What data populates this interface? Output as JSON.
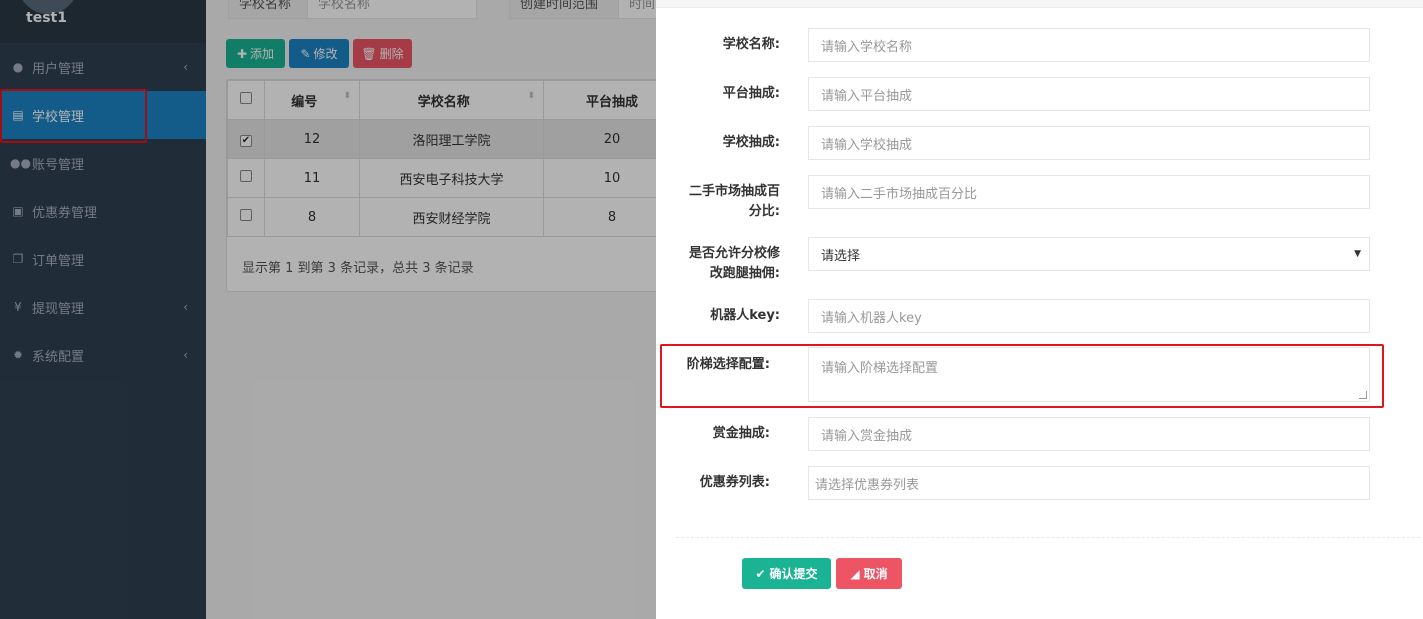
{
  "user": {
    "name": "test1"
  },
  "sidebar": {
    "items": [
      {
        "label": "用户管理",
        "icon": "user-icon",
        "glyph": "●",
        "chevron": true
      },
      {
        "label": "学校管理",
        "icon": "building-icon",
        "glyph": "▤",
        "chevron": false,
        "active": true
      },
      {
        "label": "账号管理",
        "icon": "users-icon",
        "glyph": "●●",
        "chevron": false
      },
      {
        "label": "优惠券管理",
        "icon": "money-icon",
        "glyph": "▣",
        "chevron": false
      },
      {
        "label": "订单管理",
        "icon": "clone-icon",
        "glyph": "❐",
        "chevron": false
      },
      {
        "label": "提现管理",
        "icon": "yen-icon",
        "glyph": "¥",
        "chevron": true
      },
      {
        "label": "系统配置",
        "icon": "gear-icon",
        "glyph": "✹",
        "chevron": true
      }
    ]
  },
  "search": {
    "school_label": "学校名称",
    "school_placeholder": "学校名称",
    "date_label": "创建时间范围",
    "date_placeholder": "时间"
  },
  "toolbar": {
    "add": "添加",
    "edit": "修改",
    "delete": "删除"
  },
  "table": {
    "headers": [
      "编号",
      "学校名称",
      "平台抽成"
    ],
    "rows": [
      {
        "checked": true,
        "id": "12",
        "name": "洛阳理工学院",
        "rate": "20"
      },
      {
        "checked": false,
        "id": "11",
        "name": "西安电子科技大学",
        "rate": "10"
      },
      {
        "checked": false,
        "id": "8",
        "name": "西安财经学院",
        "rate": "8"
      }
    ],
    "pager": "显示第 1 到第 3 条记录，总共 3 条记录"
  },
  "form": {
    "school_name": {
      "label": "学校名称:",
      "placeholder": "请输入学校名称"
    },
    "platform_rate": {
      "label": "平台抽成:",
      "placeholder": "请输入平台抽成"
    },
    "school_rate": {
      "label": "学校抽成:",
      "placeholder": "请输入学校抽成"
    },
    "market_rate": {
      "label_1": "二手市场抽成百",
      "label_2": "分比:",
      "placeholder": "请输入二手市场抽成百分比"
    },
    "allow_branch": {
      "label_1": "是否允许分校修",
      "label_2": "改跑腿抽佣:",
      "value": "请选择"
    },
    "robot_key": {
      "label": "机器人key:",
      "placeholder": "请输入机器人key"
    },
    "ladder": {
      "label": "阶梯选择配置:",
      "placeholder": "请输入阶梯选择配置"
    },
    "bounty_rate": {
      "label": "赏金抽成:",
      "placeholder": "请输入赏金抽成"
    },
    "coupon_list": {
      "label": "优惠券列表:",
      "placeholder": "请选择优惠券列表"
    },
    "submit": "确认提交",
    "cancel": "取消"
  },
  "colors": {
    "sidebar": "#2f4050",
    "active": "#1c84c6",
    "primary": "#1ab394",
    "danger": "#ed5565",
    "highlight": "#e5131a"
  }
}
